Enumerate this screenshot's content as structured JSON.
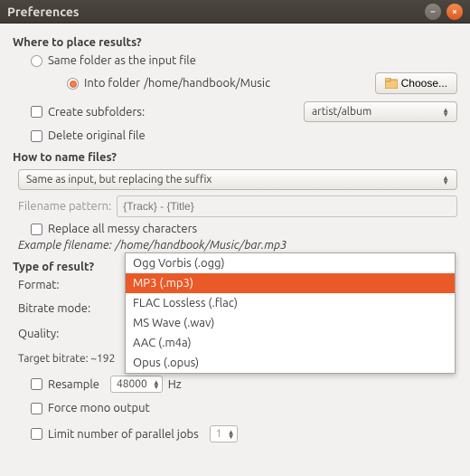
{
  "window": {
    "title": "Preferences",
    "min_icon": "–",
    "close_icon": "×"
  },
  "place": {
    "heading": "Where to place results?",
    "same_folder_label": "Same folder as the input file",
    "into_folder_label": "Into folder",
    "into_folder_path": "/home/handbook/Music",
    "choose_label": "Choose...",
    "create_subfolders_label": "Create subfolders:",
    "subfolder_pattern": "artist/album",
    "delete_original_label": "Delete original file"
  },
  "name": {
    "heading": "How to name files?",
    "mode_value": "Same as input, but replacing the suffix",
    "pattern_label": "Filename pattern:",
    "pattern_placeholder": "{Track} - {Title}",
    "replace_messy_label": "Replace all messy characters",
    "example_label": "Example filename:",
    "example_value": "/home/handbook/Music/bar.mp3"
  },
  "result": {
    "heading": "Type of result?",
    "format_label": "Format:",
    "bitrate_mode_label": "Bitrate mode:",
    "quality_label": "Quality:",
    "target_bitrate_label": "Target bitrate: ~192",
    "resample_label": "Resample",
    "resample_value": "48000",
    "resample_unit": "Hz",
    "force_mono_label": "Force mono output",
    "limit_jobs_label": "Limit number of parallel jobs",
    "limit_jobs_value": "1",
    "format_options": [
      "Ogg Vorbis (.ogg)",
      "MP3 (.mp3)",
      "FLAC Lossless (.flac)",
      "MS Wave (.wav)",
      "AAC (.m4a)",
      "Opus (.opus)"
    ],
    "format_selected_index": 1
  }
}
